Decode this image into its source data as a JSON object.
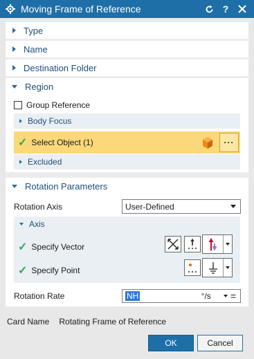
{
  "window": {
    "title": "Moving Frame of Reference"
  },
  "sections": {
    "type": "Type",
    "name": "Name",
    "destination": "Destination Folder",
    "region": "Region",
    "rotation": "Rotation Parameters"
  },
  "region": {
    "group_reference": "Group Reference",
    "group_reference_checked": false,
    "body_focus": "Body Focus",
    "select_object": "Select Object (1)",
    "select_more": "···",
    "excluded": "Excluded"
  },
  "rotation": {
    "axis_label": "Rotation Axis",
    "axis_value": "User-Defined",
    "axis_group": "Axis",
    "specify_vector": "Specify Vector",
    "specify_point": "Specify Point",
    "rate_label": "Rotation Rate",
    "rate_value": "NH",
    "rate_unit": "°/s",
    "rate_eq": "="
  },
  "card": {
    "label": "Card Name",
    "value": "Rotating Frame of Reference"
  },
  "buttons": {
    "ok": "OK",
    "cancel": "Cancel"
  },
  "colors": {
    "accent": "#1e6fa8",
    "highlight": "#fbd97a",
    "check": "#2fa84f"
  }
}
